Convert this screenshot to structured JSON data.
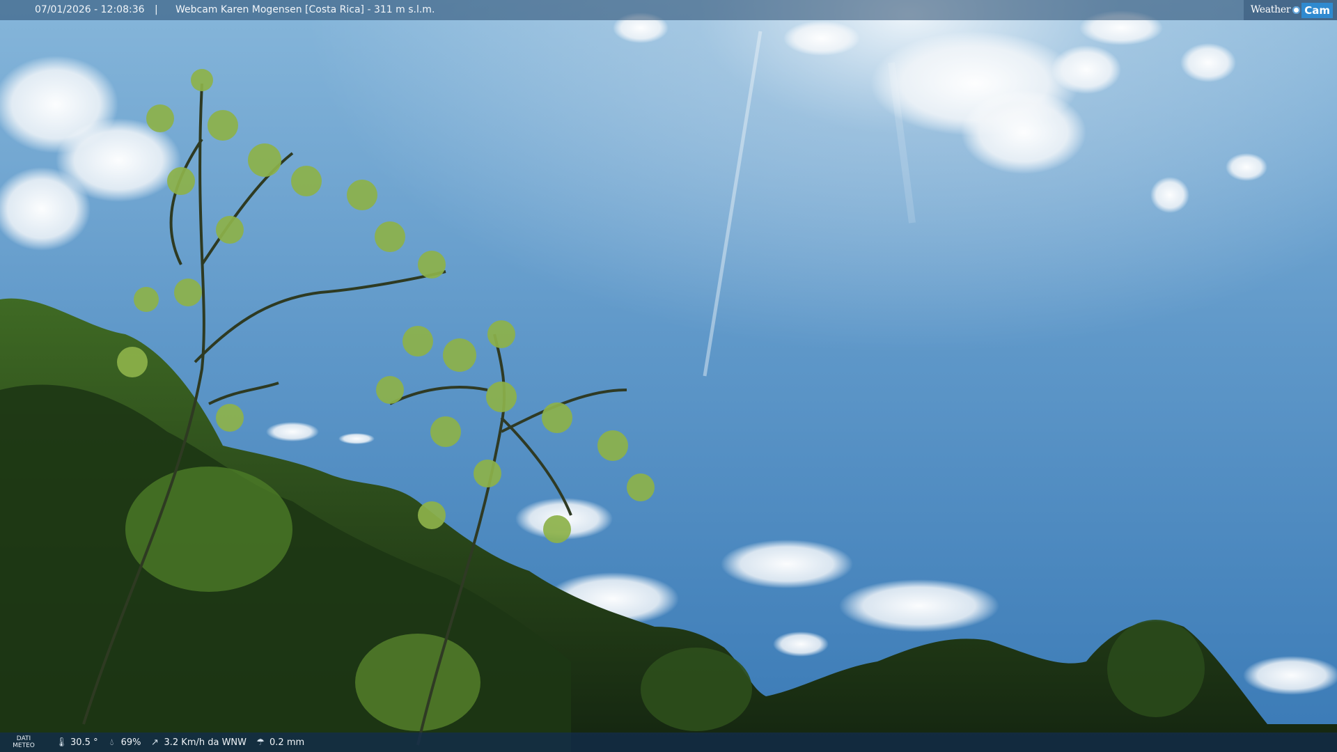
{
  "header": {
    "timestamp": "07/01/2026 - 12:08:36",
    "separator": "|",
    "title": "Webcam Karen Mogensen [Costa Rica]  - 311 m s.l.m.",
    "logo_weather": "Weather",
    "logo_cam": "Cam"
  },
  "footer": {
    "label": "DATI\nMETEO",
    "temperature": "30.5 °",
    "humidity": "69%",
    "wind": "3.2 Km/h da WNW",
    "rain": "0.2 mm",
    "icons": [
      "thermometer-icon",
      "humidity-icon",
      "wind-icon",
      "rain-icon"
    ]
  },
  "colors": {
    "sky_top": "#7aaed6",
    "sky_bottom": "#2f6fae",
    "foliage_dark": "#1c3314",
    "foliage_light": "#8fb84a"
  }
}
